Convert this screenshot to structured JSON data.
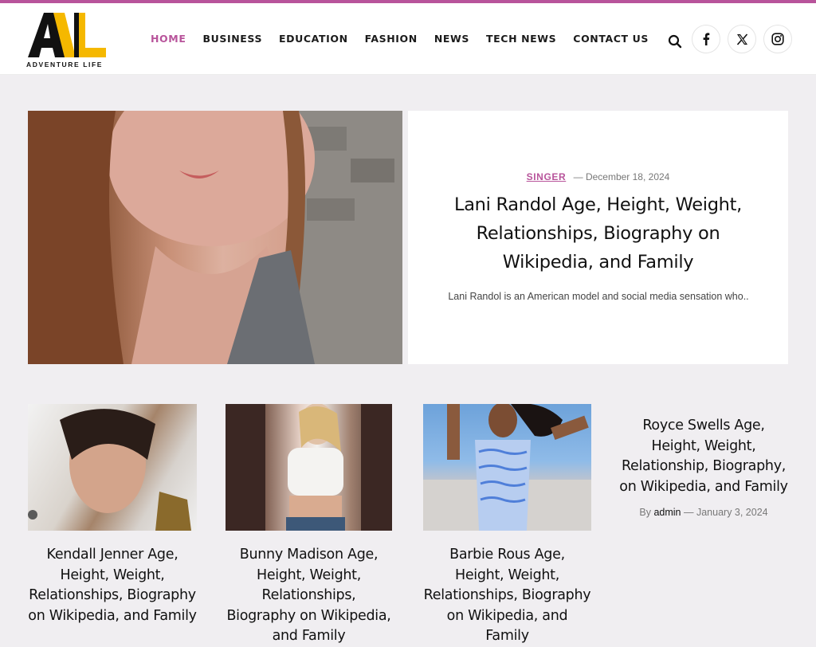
{
  "site": {
    "logo_text": "ADVENTURE LIFE"
  },
  "nav": {
    "items": [
      "HOME",
      "BUSINESS",
      "EDUCATION",
      "FASHION",
      "NEWS",
      "TECH NEWS",
      "CONTACT US"
    ],
    "active": "HOME"
  },
  "header_icons": [
    "search-icon",
    "facebook-icon",
    "x-icon",
    "instagram-icon"
  ],
  "hero": {
    "category": "SINGER",
    "date": "December 18, 2024",
    "title": "Lani Randol Age, Height, Weight, Relationships, Biography on Wikipedia, and Family",
    "excerpt": "Lani Randol is an American model and social media sensation who.."
  },
  "cards": [
    {
      "title": "Kendall Jenner Age, Height, Weight, Relationships, Biography on Wikipedia, and Family"
    },
    {
      "title": "Bunny Madison Age, Height, Weight, Relationships, Biography on Wikipedia, and Family"
    },
    {
      "title": "Barbie Rous Age, Height, Weight, Relationships, Biography on Wikipedia, and Family"
    }
  ],
  "side_post": {
    "title": "Royce Swells Age, Height, Weight, Relationship, Biography, on Wikipedia, and Family",
    "by": "By",
    "author": "admin",
    "date": "January 3, 2024"
  },
  "colors": {
    "accent": "#b8549b",
    "background": "#f0eef1",
    "logo_yellow": "#f5b800"
  }
}
